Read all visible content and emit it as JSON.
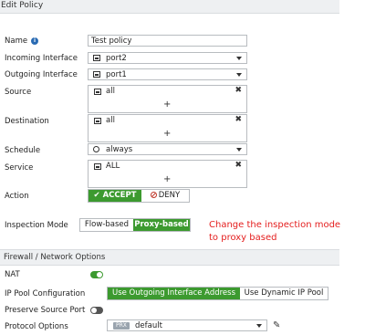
{
  "header": {
    "title": "Edit Policy"
  },
  "fields": {
    "name": {
      "label": "Name",
      "value": "Test policy"
    },
    "incoming": {
      "label": "Incoming Interface",
      "value": "port2"
    },
    "outgoing": {
      "label": "Outgoing Interface",
      "value": "port1"
    },
    "source": {
      "label": "Source",
      "value": "all"
    },
    "destination": {
      "label": "Destination",
      "value": "all"
    },
    "schedule": {
      "label": "Schedule",
      "value": "always"
    },
    "service": {
      "label": "Service",
      "value": "ALL"
    },
    "action": {
      "label": "Action",
      "accept": "ACCEPT",
      "deny": "DENY",
      "selected": "ACCEPT"
    },
    "inspection": {
      "label": "Inspection Mode",
      "flow": "Flow-based",
      "proxy": "Proxy-based",
      "selected": "Proxy-based"
    }
  },
  "annotation": {
    "text": "Change the inspection mode to proxy based"
  },
  "firewall": {
    "title": "Firewall / Network Options",
    "nat": {
      "label": "NAT",
      "on": true
    },
    "ippool": {
      "label": "IP Pool Configuration",
      "option1": "Use Outgoing Interface Address",
      "option2": "Use Dynamic IP Pool",
      "selected": "Use Outgoing Interface Address"
    },
    "preserve": {
      "label": "Preserve Source Port",
      "on": false
    },
    "protocol": {
      "label": "Protocol Options",
      "badge": "PRX",
      "value": "default"
    }
  },
  "icons": {
    "plus": "+",
    "remove": "✖",
    "check": "✔",
    "pencil": "✎"
  },
  "colors": {
    "accent_green": "#3c9a2f",
    "annotation_red": "#e41e1e",
    "info_blue": "#2a6bb3"
  }
}
